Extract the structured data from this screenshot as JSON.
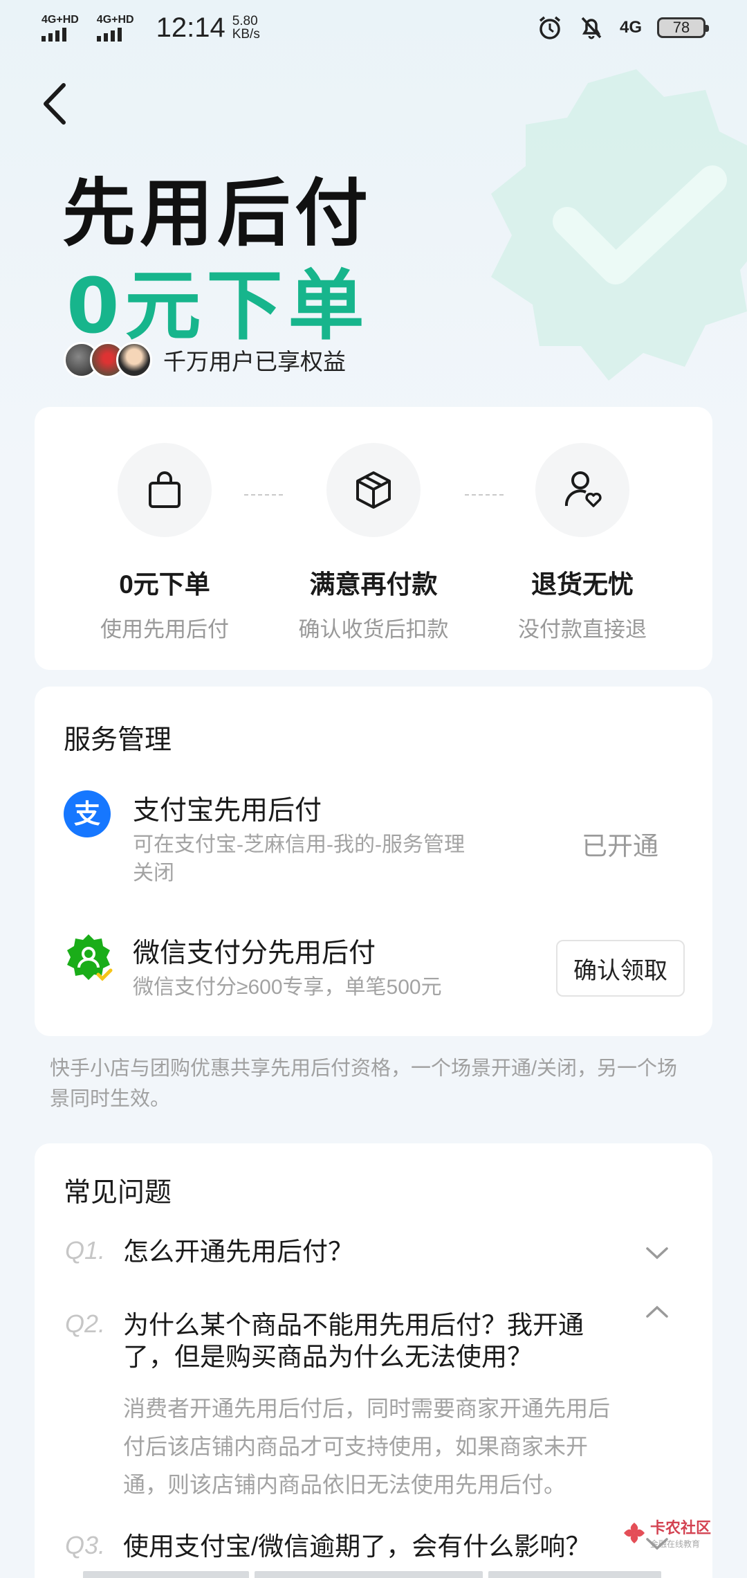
{
  "status_bar": {
    "signal_1": "4G+HD",
    "signal_2": "4G+HD",
    "time": "12:14",
    "speed_value": "5.80",
    "speed_unit": "KB/s",
    "network": "4G",
    "battery": "78"
  },
  "hero": {
    "title": "先用后付",
    "subtitle": "0元下单",
    "users_text": "千万用户已享权益"
  },
  "benefits": [
    {
      "title": "0元下单",
      "subtitle": "使用先用后付",
      "icon": "shopping-bag-icon"
    },
    {
      "title": "满意再付款",
      "subtitle": "确认收货后扣款",
      "icon": "package-box-icon"
    },
    {
      "title": "退货无忧",
      "subtitle": "没付款直接退",
      "icon": "user-heart-icon"
    }
  ],
  "service": {
    "title": "服务管理",
    "alipay": {
      "name": "支付宝先用后付",
      "desc_line1": "可在支付宝-芝麻信用-我的-服务管理",
      "desc_line2": "关闭",
      "status": "已开通",
      "icon": "alipay-icon",
      "icon_glyph": "支"
    },
    "wechat": {
      "name": "微信支付分先用后付",
      "desc": "微信支付分≥600专享，单笔500元",
      "button": "确认领取",
      "icon": "wechat-pay-score-icon"
    }
  },
  "note": "快手小店与团购优惠共享先用后付资格，一个场景开通/关闭，另一个场景同时生效。",
  "faq": {
    "title": "常见问题",
    "items": [
      {
        "no": "Q1.",
        "question": "怎么开通先用后付？",
        "expanded": false
      },
      {
        "no": "Q2.",
        "question_line1": "为什么某个商品不能用先用后付？我开通",
        "question_line2": "了，但是购买商品为什么无法使用？",
        "answer_line1": "消费者开通先用后付后，同时需要商家开通先用后",
        "answer_line2": "付后该店铺内商品才可支持使用，如果商家未开",
        "answer_line3": "通，则该店铺内商品依旧无法使用先用后付。",
        "expanded": true
      },
      {
        "no": "Q3.",
        "question": "使用支付宝/微信逾期了，会有什么影响？",
        "expanded": false
      }
    ]
  },
  "watermark": {
    "main": "卡农社区",
    "sub": "金融在线教育"
  },
  "colors": {
    "accent": "#17b58c",
    "alipay_blue": "#1677ff",
    "wechat_green": "#1aad19"
  }
}
